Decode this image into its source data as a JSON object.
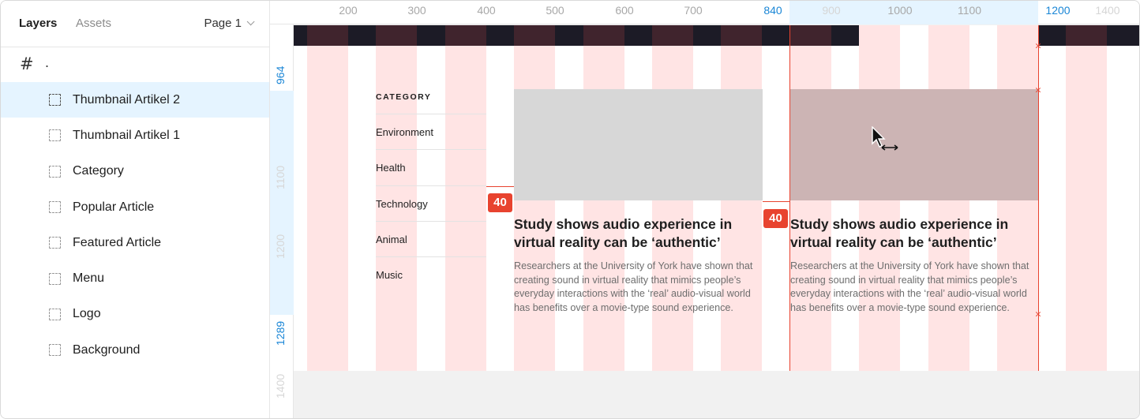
{
  "panel": {
    "tabs": {
      "layers": "Layers",
      "assets": "Assets"
    },
    "page_selector": "Page 1",
    "frame": {
      "icon": "hash-icon",
      "name": "."
    },
    "layers": [
      {
        "label": "Thumbnail Artikel 2",
        "selected": true
      },
      {
        "label": "Thumbnail Artikel 1",
        "selected": false
      },
      {
        "label": "Category",
        "selected": false
      },
      {
        "label": "Popular Article",
        "selected": false
      },
      {
        "label": "Featured Article",
        "selected": false
      },
      {
        "label": "Menu",
        "selected": false
      },
      {
        "label": "Logo",
        "selected": false
      },
      {
        "label": "Background",
        "selected": false
      }
    ]
  },
  "ruler": {
    "x_ticks": [
      "200",
      "300",
      "400",
      "500",
      "600",
      "700",
      "840",
      "900",
      "1000",
      "1100",
      "1200",
      "1400"
    ],
    "y_ticks": [
      "964",
      "1100",
      "1200",
      "1289",
      "1400"
    ]
  },
  "canvas": {
    "category": {
      "title": "CATEGORY",
      "items": [
        "Environment",
        "Health",
        "Technology",
        "Animal",
        "Music"
      ]
    },
    "cards": [
      {
        "title": "Study shows audio experience in virtual reality can be ‘authentic’",
        "body": "Researchers at the University of York have shown that creating sound in virtual reality that mimics people’s everyday interactions with the ‘real’ audio-visual world has benefits over a movie-type sound experience."
      },
      {
        "title": "Study shows audio experience in virtual reality can be ‘authentic’",
        "body": "Researchers at the University of York have shown that creating sound in virtual reality that mimics people’s everyday interactions with the ‘real’ audio-visual world has benefits over a movie-type sound experience."
      }
    ],
    "spacing_badges": [
      "40",
      "40"
    ]
  },
  "colors": {
    "accent_selection": "#e5f4ff",
    "ruler_highlight": "#1a86d6",
    "guide_red": "#e8432f",
    "layout_grid": "#ffdcdc"
  }
}
